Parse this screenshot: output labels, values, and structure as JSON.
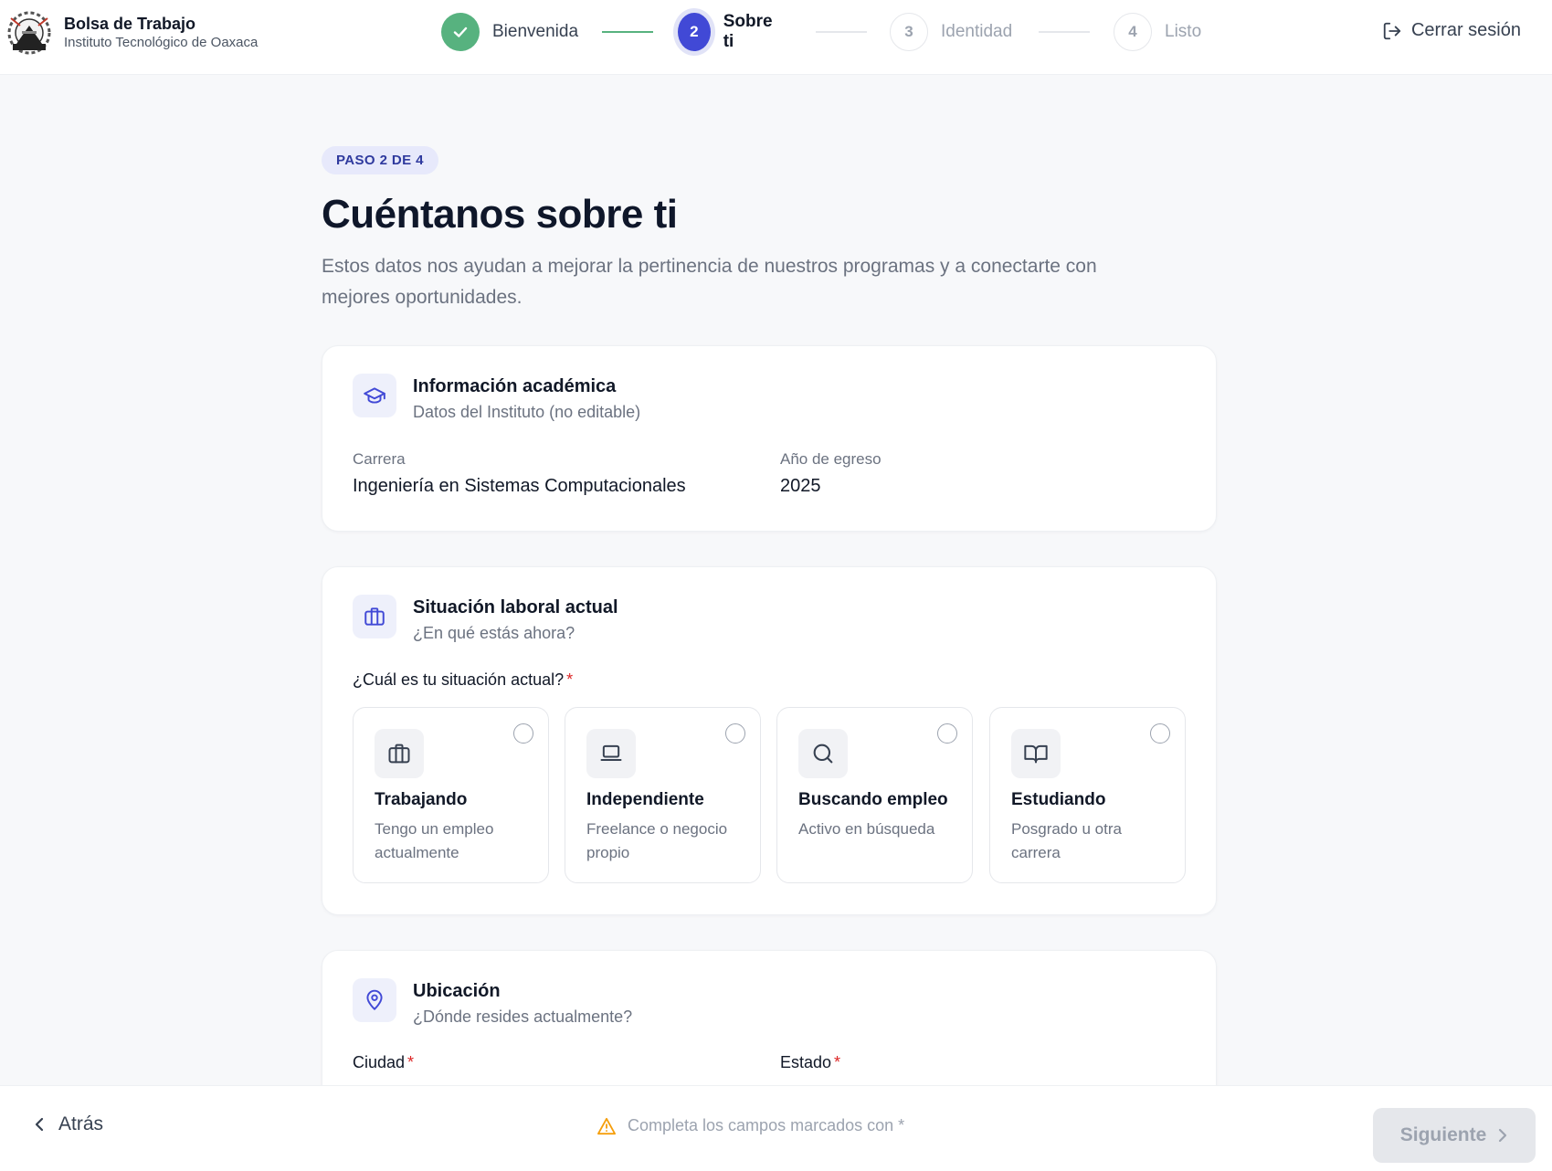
{
  "header": {
    "brand_title": "Bolsa de Trabajo",
    "brand_subtitle": "Instituto Tecnológico de Oaxaca",
    "logout_label": "Cerrar sesión"
  },
  "stepper": {
    "steps": [
      {
        "number": "",
        "label": "Bienvenida",
        "state": "done"
      },
      {
        "number": "2",
        "label": "Sobre ti",
        "state": "current"
      },
      {
        "number": "3",
        "label": "Identidad",
        "state": "todo"
      },
      {
        "number": "4",
        "label": "Listo",
        "state": "todo"
      }
    ]
  },
  "main": {
    "step_badge": "PASO 2 DE 4",
    "title": "Cuéntanos sobre ti",
    "description": "Estos datos nos ayudan a mejorar la pertinencia de nuestros programas y a conectarte con mejores oportunidades."
  },
  "academic": {
    "title": "Información académica",
    "subtitle": "Datos del Instituto (no editable)",
    "career_label": "Carrera",
    "career_value": "Ingeniería en Sistemas Computacionales",
    "year_label": "Año de egreso",
    "year_value": "2025"
  },
  "employment": {
    "title": "Situación laboral actual",
    "subtitle": "¿En qué estás ahora?",
    "question": "¿Cuál es tu situación actual?",
    "required_mark": "*",
    "options": [
      {
        "title": "Trabajando",
        "desc": "Tengo un empleo actualmente",
        "icon": "briefcase-icon"
      },
      {
        "title": "Independiente",
        "desc": "Freelance o negocio propio",
        "icon": "laptop-icon"
      },
      {
        "title": "Buscando empleo",
        "desc": "Activo en búsqueda",
        "icon": "search-icon"
      },
      {
        "title": "Estudiando",
        "desc": "Posgrado u otra carrera",
        "icon": "book-icon"
      }
    ]
  },
  "location": {
    "title": "Ubicación",
    "subtitle": "¿Dónde resides actualmente?",
    "city_label": "Ciudad",
    "state_label": "Estado",
    "required_mark": "*"
  },
  "footer": {
    "back_label": "Atrás",
    "hint": "Completa los campos marcados con *",
    "next_label": "Siguiente"
  },
  "colors": {
    "primary": "#4149d6",
    "success": "#57b27f",
    "warning": "#f59e0b",
    "required": "#dc2626"
  }
}
